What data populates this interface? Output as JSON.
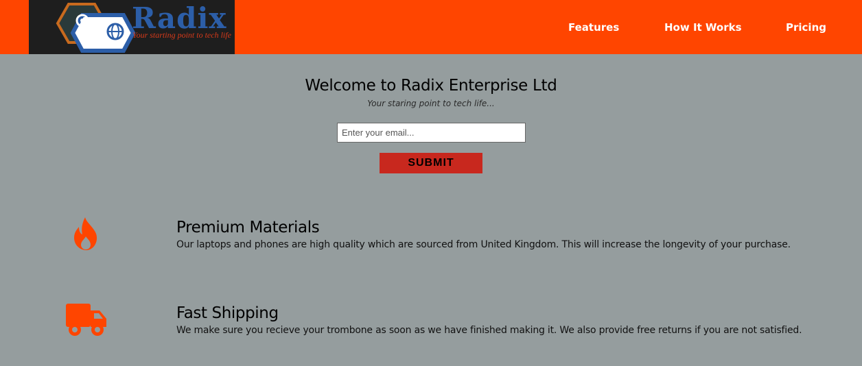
{
  "brand": {
    "name": "Radix",
    "tagline": "Your starting point to tech life"
  },
  "nav": {
    "items": [
      {
        "label": "Features"
      },
      {
        "label": "How It Works"
      },
      {
        "label": "Pricing"
      }
    ]
  },
  "hero": {
    "title": "Welcome to Radix Enterprise Ltd",
    "subtitle": "Your staring point to tech life...",
    "email_placeholder": "Enter your email...",
    "submit_label": "SUBMIT"
  },
  "features": [
    {
      "icon": "fire-icon",
      "title": "Premium Materials",
      "description": "Our laptops and phones are high quality which are sourced from United Kingdom. This will increase the longevity of your purchase."
    },
    {
      "icon": "truck-icon",
      "title": "Fast Shipping",
      "description": "We make sure you recieve your trombone as soon as we have finished making it. We also provide free returns if you are not satisfied."
    }
  ],
  "colors": {
    "header": "#ff4500",
    "background": "#959d9e",
    "submit": "#c8281e",
    "icon": "#ff4500"
  }
}
